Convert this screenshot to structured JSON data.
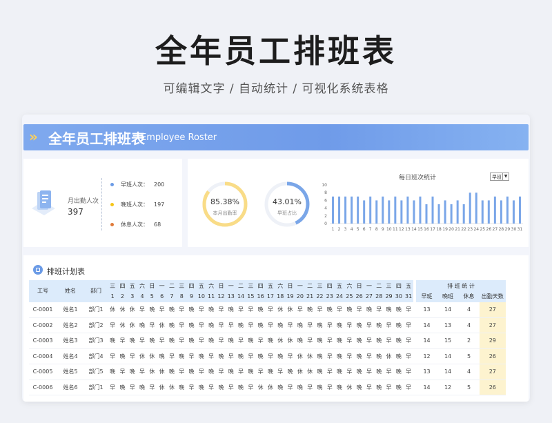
{
  "page": {
    "title": "全年员工排班表",
    "subtitle": "可编辑文字 / 自动统计 / 可视化系统表格"
  },
  "banner": {
    "chevrons": "»",
    "title": "全年员工排班表",
    "subtitle": "Employee Roster"
  },
  "summary": {
    "attendance_label": "月出勤人次",
    "attendance_value": "397",
    "stats": [
      {
        "label": "早班人次：",
        "value": "200",
        "color": "#6b9be6"
      },
      {
        "label": "晚班人次：",
        "value": "197",
        "color": "#f5c518"
      },
      {
        "label": "休息人次：",
        "value": "68",
        "color": "#e07a3a"
      }
    ]
  },
  "rings": [
    {
      "value": "85.38%",
      "label": "本月出勤率",
      "fraction": 0.8538,
      "color": "#f9dc87"
    },
    {
      "value": "43.01%",
      "label": "早班占比",
      "fraction": 0.4301,
      "color": "#7aa6e8"
    }
  ],
  "bar_chart_title": "每日班次统计",
  "selector": {
    "value": "早班",
    "arrow": "▼"
  },
  "chart_data": {
    "type": "bar",
    "categories": [
      "1",
      "2",
      "3",
      "4",
      "5",
      "6",
      "7",
      "8",
      "9",
      "10",
      "11",
      "12",
      "13",
      "14",
      "15",
      "16",
      "17",
      "18",
      "19",
      "20",
      "21",
      "22",
      "23",
      "24",
      "25",
      "26",
      "27",
      "28",
      "29",
      "30",
      "31"
    ],
    "values": [
      7,
      7,
      7,
      7,
      7,
      6,
      7,
      6,
      7,
      6,
      7,
      6,
      7,
      6,
      7,
      5,
      7,
      5,
      6,
      5,
      6,
      5,
      8,
      8,
      6,
      6,
      7,
      6,
      7,
      6,
      7
    ],
    "ylim": [
      0,
      10
    ],
    "yticks": [
      "0",
      "2",
      "4",
      "6",
      "8",
      "10"
    ],
    "color": "#7aa6e8"
  },
  "table": {
    "title": "排班计划表",
    "headers": {
      "id": "工号",
      "name": "姓名",
      "dept": "部门",
      "stats_group": "排 班 统 计"
    },
    "weekdays": [
      "三",
      "四",
      "五",
      "六",
      "日",
      "一",
      "二",
      "三",
      "四",
      "五",
      "六",
      "日",
      "一",
      "二",
      "三",
      "四",
      "五",
      "六",
      "日",
      "一",
      "二",
      "三",
      "四",
      "五",
      "六",
      "日",
      "一",
      "二",
      "三",
      "四",
      "五"
    ],
    "days": [
      "1",
      "2",
      "3",
      "4",
      "5",
      "6",
      "7",
      "8",
      "9",
      "10",
      "11",
      "12",
      "13",
      "14",
      "15",
      "16",
      "17",
      "18",
      "19",
      "20",
      "21",
      "22",
      "23",
      "24",
      "25",
      "26",
      "27",
      "28",
      "29",
      "30",
      "31"
    ],
    "stat_headers": [
      "早班",
      "晚班",
      "休息",
      "出勤天数"
    ],
    "rows": [
      {
        "id": "C-0001",
        "name": "姓名1",
        "dept": "部门1",
        "shifts": [
          "休",
          "休",
          "休",
          "早",
          "晚",
          "早",
          "晚",
          "早",
          "晚",
          "早",
          "晚",
          "早",
          "晚",
          "早",
          "早",
          "晚",
          "早",
          "休",
          "休",
          "早",
          "晚",
          "早",
          "晚",
          "早",
          "晚",
          "早",
          "晚",
          "早",
          "晚",
          "晚",
          "早"
        ],
        "stats": [
          "13",
          "14",
          "4",
          "27"
        ]
      },
      {
        "id": "C-0002",
        "name": "姓名2",
        "dept": "部门2",
        "shifts": [
          "早",
          "休",
          "休",
          "晚",
          "早",
          "休",
          "晚",
          "早",
          "晚",
          "早",
          "晚",
          "早",
          "早",
          "晚",
          "早",
          "晚",
          "早",
          "晚",
          "早",
          "晚",
          "早",
          "晚",
          "早",
          "晚",
          "早",
          "晚",
          "早",
          "晚",
          "早",
          "晚",
          "早"
        ],
        "stats": [
          "14",
          "13",
          "4",
          "27"
        ]
      },
      {
        "id": "C-0003",
        "name": "姓名3",
        "dept": "部门3",
        "shifts": [
          "晚",
          "早",
          "晚",
          "早",
          "晚",
          "早",
          "晚",
          "早",
          "晚",
          "早",
          "晚",
          "早",
          "晚",
          "早",
          "晚",
          "早",
          "晚",
          "休",
          "休",
          "晚",
          "早",
          "晚",
          "早",
          "晚",
          "早",
          "晚",
          "早",
          "晚",
          "早",
          "晚",
          "早"
        ],
        "stats": [
          "14",
          "15",
          "2",
          "29"
        ]
      },
      {
        "id": "C-0004",
        "name": "姓名4",
        "dept": "部门4",
        "shifts": [
          "早",
          "晚",
          "早",
          "休",
          "休",
          "晚",
          "早",
          "晚",
          "早",
          "晚",
          "早",
          "晚",
          "早",
          "晚",
          "早",
          "晚",
          "早",
          "晚",
          "早",
          "休",
          "休",
          "晚",
          "早",
          "晚",
          "早",
          "晚",
          "早",
          "晚",
          "休",
          "晚",
          "早"
        ],
        "stats": [
          "12",
          "14",
          "5",
          "26"
        ]
      },
      {
        "id": "C-0005",
        "name": "姓名5",
        "dept": "部门5",
        "shifts": [
          "晚",
          "早",
          "晚",
          "早",
          "休",
          "休",
          "晚",
          "早",
          "晚",
          "早",
          "晚",
          "早",
          "晚",
          "早",
          "晚",
          "早",
          "晚",
          "早",
          "晚",
          "休",
          "休",
          "晚",
          "早",
          "晚",
          "早",
          "晚",
          "早",
          "晚",
          "早",
          "晚",
          "早"
        ],
        "stats": [
          "13",
          "14",
          "4",
          "27"
        ]
      },
      {
        "id": "C-0006",
        "name": "姓名6",
        "dept": "部门1",
        "shifts": [
          "早",
          "晚",
          "早",
          "晚",
          "早",
          "休",
          "休",
          "晚",
          "早",
          "晚",
          "早",
          "晚",
          "早",
          "晚",
          "早",
          "休",
          "休",
          "晚",
          "早",
          "晚",
          "早",
          "晚",
          "早",
          "晚",
          "休",
          "晚",
          "早",
          "晚",
          "早",
          "晚",
          "早"
        ],
        "stats": [
          "14",
          "12",
          "5",
          "26"
        ]
      }
    ]
  }
}
